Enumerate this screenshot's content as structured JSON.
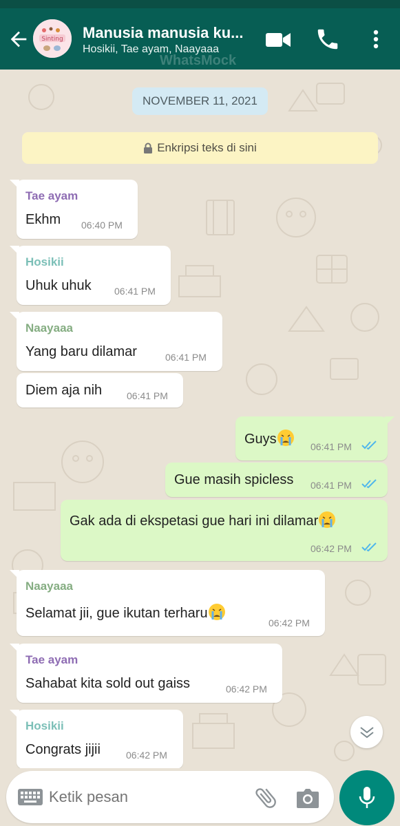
{
  "header": {
    "title": "Manusia manusia ku...",
    "subtitle": "Hosikii, Tae ayam, Naayaaa",
    "watermark": "WhatsMock",
    "avatar_text": "Sinting"
  },
  "chat": {
    "date": "NOVEMBER 11, 2021",
    "encryption_notice": "Enkripsi teks di sini",
    "messages": [
      {
        "direction": "in",
        "sender": "Tae ayam",
        "sender_color": "#8e6cb3",
        "text": "Ekhm",
        "time": "06:40 PM"
      },
      {
        "direction": "in",
        "sender": "Hosikii",
        "sender_color": "#7bbfb7",
        "text": "Uhuk uhuk",
        "time": "06:41 PM"
      },
      {
        "direction": "in",
        "sender": "Naayaaa",
        "sender_color": "#85ad82",
        "text": "Yang baru dilamar",
        "time": "06:41 PM"
      },
      {
        "direction": "in",
        "sender": "",
        "text": "Diem aja nih",
        "time": "06:41 PM"
      },
      {
        "direction": "out",
        "text": "Guys",
        "emoji": "crying-face",
        "time": "06:41 PM",
        "status": "read"
      },
      {
        "direction": "out",
        "text": "Gue masih spicless",
        "time": "06:41 PM",
        "status": "read"
      },
      {
        "direction": "out",
        "text": "Gak ada di ekspetasi gue hari ini dilamar",
        "emoji": "crying-face",
        "time": "06:42 PM",
        "status": "read"
      },
      {
        "direction": "in",
        "sender": "Naayaaa",
        "sender_color": "#85ad82",
        "text": "Selamat jii, gue ikutan terharu",
        "emoji": "crying-face",
        "time": "06:42 PM"
      },
      {
        "direction": "in",
        "sender": "Tae ayam",
        "sender_color": "#8e6cb3",
        "text": "Sahabat kita sold out gaiss",
        "time": "06:42 PM"
      },
      {
        "direction": "in",
        "sender": "Hosikii",
        "sender_color": "#7bbfb7",
        "text": "Congrats jijii",
        "time": "06:42 PM"
      }
    ]
  },
  "composer": {
    "placeholder": "Ketik pesan"
  },
  "colors": {
    "header": "#075e54",
    "outgoing_bubble": "#dcf8c6",
    "incoming_bubble": "#ffffff",
    "read_ticks": "#4fb6ec",
    "fab": "#00897b"
  }
}
